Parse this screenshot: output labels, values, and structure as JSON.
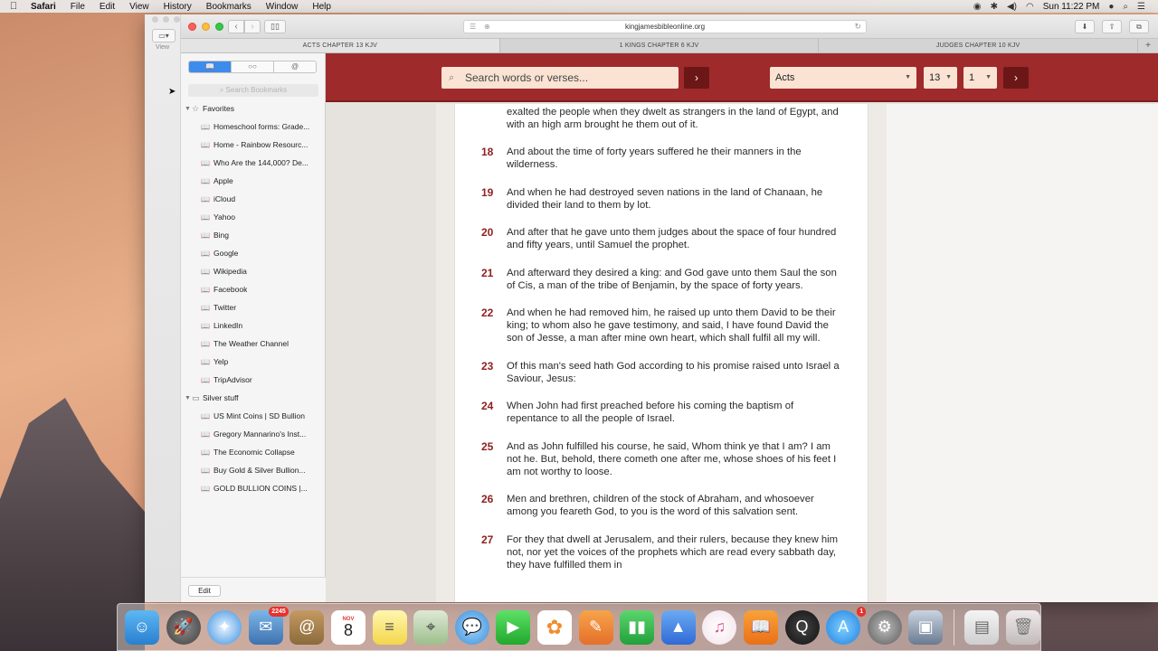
{
  "menubar": {
    "app": "Safari",
    "items": [
      "File",
      "Edit",
      "View",
      "History",
      "Bookmarks",
      "Window",
      "Help"
    ],
    "clock": "Sun 11:22 PM"
  },
  "toolbar": {
    "url": "kingjamesbibleonline.org",
    "view_label": "View"
  },
  "tabs": [
    "ACTS CHAPTER 13 KJV",
    "1 KINGS CHAPTER 6 KJV",
    "JUDGES CHAPTER 10 KJV"
  ],
  "sidebar": {
    "search_placeholder": "Search Bookmarks",
    "favorites_label": "Favorites",
    "favorites": [
      "Homeschool forms: Grade...",
      "Home - Rainbow Resourc...",
      "Who Are the 144,000? De...",
      "Apple",
      "iCloud",
      "Yahoo",
      "Bing",
      "Google",
      "Wikipedia",
      "Facebook",
      "Twitter",
      "LinkedIn",
      "The Weather Channel",
      "Yelp",
      "TripAdvisor"
    ],
    "folder_label": "Silver stuff",
    "folder_items": [
      "US Mint Coins | SD Bullion",
      "Gregory Mannarino's Inst...",
      "The Economic Collapse",
      "Buy Gold & Silver Bullion...",
      "GOLD BULLION COINS |..."
    ],
    "edit_label": "Edit"
  },
  "page": {
    "search_placeholder": "Search words or verses...",
    "book": "Acts",
    "chapter": "13",
    "verse": "1",
    "lead_text": "exalted the people when they dwelt as strangers in the land of Egypt, and with an high arm brought he them out of it.",
    "verses": [
      {
        "num": "18",
        "text": "And about the time of forty years suffered he their manners in the wilderness."
      },
      {
        "num": "19",
        "text": "And when he had destroyed seven nations in the land of Chanaan, he divided their land to them by lot."
      },
      {
        "num": "20",
        "text": "And after that he gave unto them judges about the space of four hundred and fifty years, until Samuel the prophet."
      },
      {
        "num": "21",
        "text": "And afterward they desired a king: and God gave unto them Saul the son of Cis, a man of the tribe of Benjamin, by the space of forty years."
      },
      {
        "num": "22",
        "text": "And when he had removed him, he raised up unto them David to be their king; to whom also he gave testimony, and said, I have found David the son of Jesse, a man after mine own heart, which shall fulfil all my will."
      },
      {
        "num": "23",
        "text": "Of this man's seed hath God according to his promise raised unto Israel a Saviour, Jesus:"
      },
      {
        "num": "24",
        "text": "When John had first preached before his coming the baptism of repentance to all the people of Israel."
      },
      {
        "num": "25",
        "text": "And as John fulfilled his course, he said, Whom think ye that I am? I am not he. But, behold, there cometh one after me, whose shoes of his feet I am not worthy to loose."
      },
      {
        "num": "26",
        "text": "Men and brethren, children of the stock of Abraham, and whosoever among you feareth God, to you is the word of this salvation sent."
      },
      {
        "num": "27",
        "text": "For they that dwell at Jerusalem, and their rulers, because they knew him not, nor yet the voices of the prophets which are read every sabbath day, they have fulfilled them in"
      }
    ]
  },
  "dock": {
    "mail_badge": "2245",
    "calendar_month": "NOV",
    "calendar_day": "8",
    "appstore_badge": "1"
  }
}
